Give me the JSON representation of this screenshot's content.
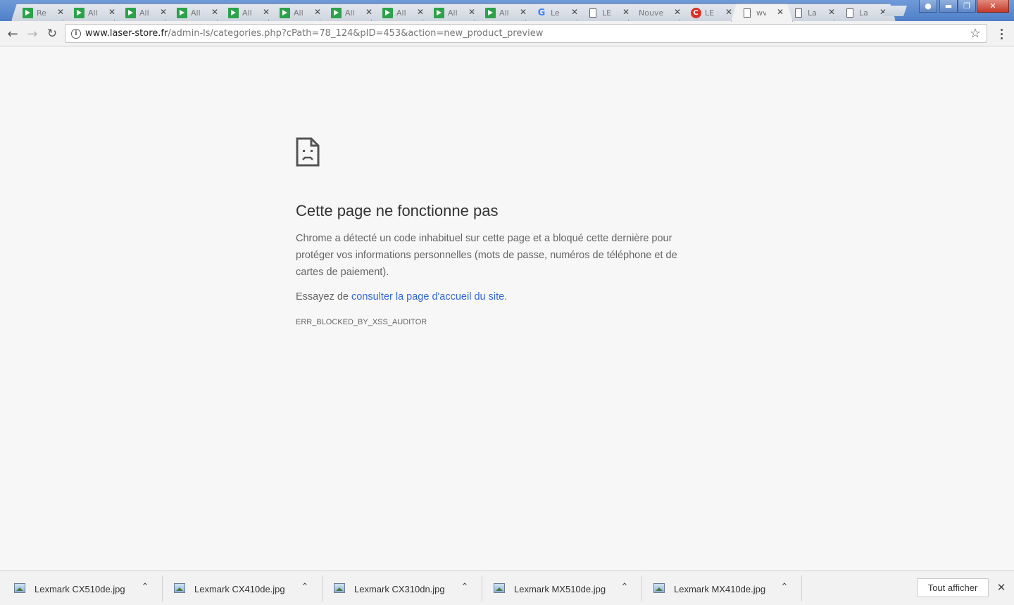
{
  "tabs": [
    {
      "title": "Re",
      "favicon": "green-play-icon",
      "active": false
    },
    {
      "title": "All",
      "favicon": "green-play-icon",
      "active": false
    },
    {
      "title": "All",
      "favicon": "green-play-icon",
      "active": false
    },
    {
      "title": "All",
      "favicon": "green-play-icon",
      "active": false
    },
    {
      "title": "All",
      "favicon": "green-play-icon",
      "active": false
    },
    {
      "title": "All",
      "favicon": "green-play-icon",
      "active": false
    },
    {
      "title": "All",
      "favicon": "green-play-icon",
      "active": false
    },
    {
      "title": "All",
      "favicon": "green-play-icon",
      "active": false
    },
    {
      "title": "All",
      "favicon": "green-play-icon",
      "active": false
    },
    {
      "title": "All",
      "favicon": "green-play-icon",
      "active": false
    },
    {
      "title": "Le",
      "favicon": "google-icon",
      "active": false
    },
    {
      "title": "LE",
      "favicon": "document-icon",
      "active": false
    },
    {
      "title": "Nouve",
      "favicon": "none",
      "active": false
    },
    {
      "title": "LE",
      "favicon": "red-c-icon",
      "active": false
    },
    {
      "title": "wv",
      "favicon": "document-icon",
      "active": true
    },
    {
      "title": "La",
      "favicon": "document-icon",
      "active": false
    },
    {
      "title": "La",
      "favicon": "document-icon",
      "active": false
    }
  ],
  "toolbar": {
    "url_host": "www.laser-store.fr",
    "url_path": "/admin-ls/categories.php?cPath=78_124&pID=453&action=new_product_preview"
  },
  "error": {
    "title": "Cette page ne fonctionne pas",
    "description": "Chrome a détecté un code inhabituel sur cette page et a bloqué cette dernière pour protéger vos informations personnelles (mots de passe, numéros de téléphone et de cartes de paiement).",
    "suggest_prefix": "Essayez de ",
    "suggest_link": "consulter la page d'accueil du site",
    "suggest_suffix": ".",
    "code": "ERR_BLOCKED_BY_XSS_AUDITOR"
  },
  "downloads": [
    {
      "name": "Lexmark CX510de.jpg"
    },
    {
      "name": "Lexmark CX410de.jpg"
    },
    {
      "name": "Lexmark CX310dn.jpg"
    },
    {
      "name": "Lexmark MX510de.jpg"
    },
    {
      "name": "Lexmark MX410de.jpg"
    }
  ],
  "shelf": {
    "show_all_label": "Tout afficher"
  },
  "colors": {
    "link": "#3367d6",
    "page_bg": "#f7f7f7",
    "title_bar": "#5b86cc"
  }
}
